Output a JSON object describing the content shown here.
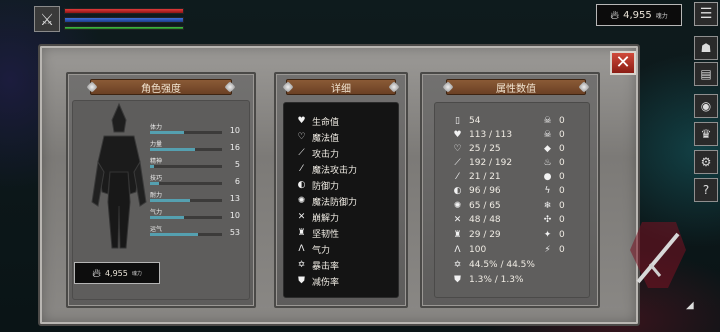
{
  "hud": {
    "currency_value": "4,955",
    "currency_unit": "魂力",
    "menu_icon": "list-icon"
  },
  "panels": {
    "character_title": "角色强度",
    "detail_title": "详细",
    "attributes_title": "属性数值"
  },
  "character_stats": [
    {
      "label": "体力",
      "value": "10",
      "fill": 0.47
    },
    {
      "label": "力量",
      "value": "16",
      "fill": 0.62
    },
    {
      "label": "精神",
      "value": "5",
      "fill": 0.05
    },
    {
      "label": "技巧",
      "value": "6",
      "fill": 0.12
    },
    {
      "label": "耐力",
      "value": "13",
      "fill": 0.55
    },
    {
      "label": "气力",
      "value": "10",
      "fill": 0.47
    },
    {
      "label": "运气",
      "value": "53",
      "fill": 0.66
    }
  ],
  "character_currency": {
    "value": "4,955",
    "unit": "魂力"
  },
  "details": [
    {
      "label": "生命值",
      "icon": "heart-icon"
    },
    {
      "label": "魔法值",
      "icon": "mana-heart-icon"
    },
    {
      "label": "攻击力",
      "icon": "sword-icon"
    },
    {
      "label": "魔法攻击力",
      "icon": "wand-icon"
    },
    {
      "label": "防御力",
      "icon": "shield-icon"
    },
    {
      "label": "魔法防御力",
      "icon": "magic-shield-icon"
    },
    {
      "label": "崩解力",
      "icon": "crossed-swords-icon"
    },
    {
      "label": "坚韧性",
      "icon": "fortress-icon"
    },
    {
      "label": "气力",
      "icon": "lungs-icon"
    },
    {
      "label": "暴击率",
      "icon": "crit-star-icon"
    },
    {
      "label": "减伤率",
      "icon": "damage-shield-icon"
    }
  ],
  "attributes_left": [
    {
      "value": "54",
      "icon": "weight-icon"
    },
    {
      "value": "113 / 113",
      "icon": "heart-icon"
    },
    {
      "value": "25 / 25",
      "icon": "mana-heart-icon"
    },
    {
      "value": "192 / 192",
      "icon": "sword-icon"
    },
    {
      "value": "21 / 21",
      "icon": "wand-icon"
    },
    {
      "value": "96 / 96",
      "icon": "shield-icon"
    },
    {
      "value": "65 / 65",
      "icon": "magic-shield-icon"
    },
    {
      "value": "48 / 48",
      "icon": "crossed-swords-icon"
    },
    {
      "value": "29 / 29",
      "icon": "fortress-icon"
    },
    {
      "value": "100",
      "icon": "lungs-icon"
    },
    {
      "value": "44.5% / 44.5%",
      "icon": "crit-star-icon"
    },
    {
      "value": "1.3% / 1.3%",
      "icon": "damage-shield-icon"
    }
  ],
  "attributes_right": [
    {
      "value": "0",
      "icon": "skull-icon"
    },
    {
      "value": "0",
      "icon": "skull-crossbones-icon"
    },
    {
      "value": "0",
      "icon": "blood-drop-icon"
    },
    {
      "value": "0",
      "icon": "fire-icon"
    },
    {
      "value": "0",
      "icon": "water-drop-icon"
    },
    {
      "value": "0",
      "icon": "lightning-icon"
    },
    {
      "value": "0",
      "icon": "frost-icon"
    },
    {
      "value": "0",
      "icon": "poison-icon"
    },
    {
      "value": "0",
      "icon": "bone-icon"
    },
    {
      "value": "0",
      "icon": "slash-icon"
    }
  ]
}
